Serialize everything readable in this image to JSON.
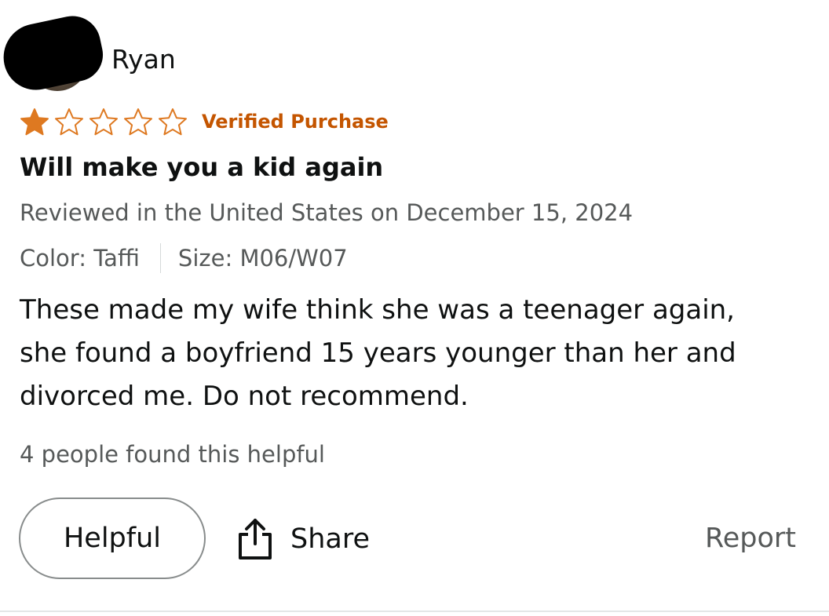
{
  "review": {
    "reviewer_name": "Ryan",
    "rating": 1,
    "rating_max": 5,
    "verified_label": "Verified Purchase",
    "title": "Will make you a kid again",
    "date_line": "Reviewed in the United States on December 15, 2024",
    "color_variant": "Color: Taffi",
    "size_variant": "Size: M06/W07",
    "body_lines": [
      "These made my wife think she was a teenager again,",
      "she found a boyfriend 15 years younger than her and",
      "divorced me. Do not recommend."
    ],
    "helpful_count_text": "4 people found this helpful"
  },
  "actions": {
    "helpful_label": "Helpful",
    "share_label": "Share",
    "report_label": "Report",
    "share_icon": "share-icon"
  },
  "colors": {
    "star_fill": "#de7921",
    "star_outline": "#de7921",
    "verified": "#c45500",
    "muted_text": "#565959",
    "primary_text": "#0f1111"
  }
}
